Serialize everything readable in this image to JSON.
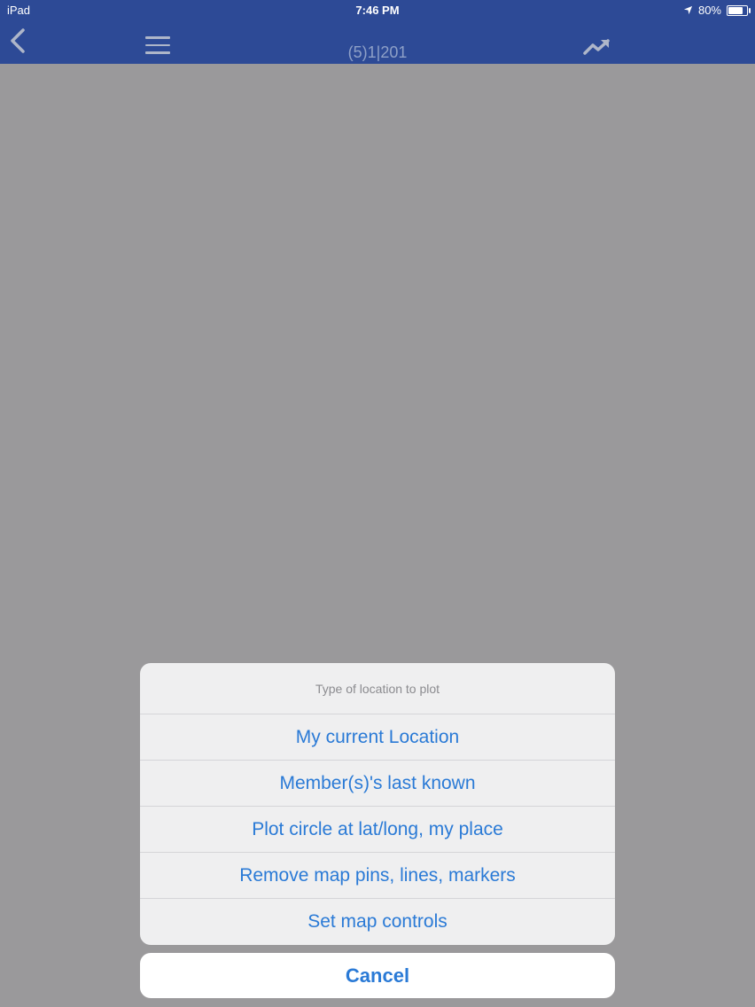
{
  "status_bar": {
    "device": "iPad",
    "time": "7:46 PM",
    "battery": "80%",
    "battery_level": 0.8
  },
  "nav": {
    "title": "(5)1|201",
    "back_icon": "chevron-left-icon",
    "menu_icon": "hamburger-icon",
    "trend_icon": "trending-up-icon"
  },
  "action_sheet": {
    "title": "Type of location to plot",
    "options": [
      "My current Location",
      "Member(s)'s last known",
      "Plot circle at lat/long, my place",
      "Remove map pins, lines, markers",
      "Set map controls"
    ],
    "cancel": "Cancel"
  },
  "colors": {
    "nav_bar": "#2d4a96",
    "overlay": "#9a999b",
    "action_text": "#2a7ad6"
  }
}
